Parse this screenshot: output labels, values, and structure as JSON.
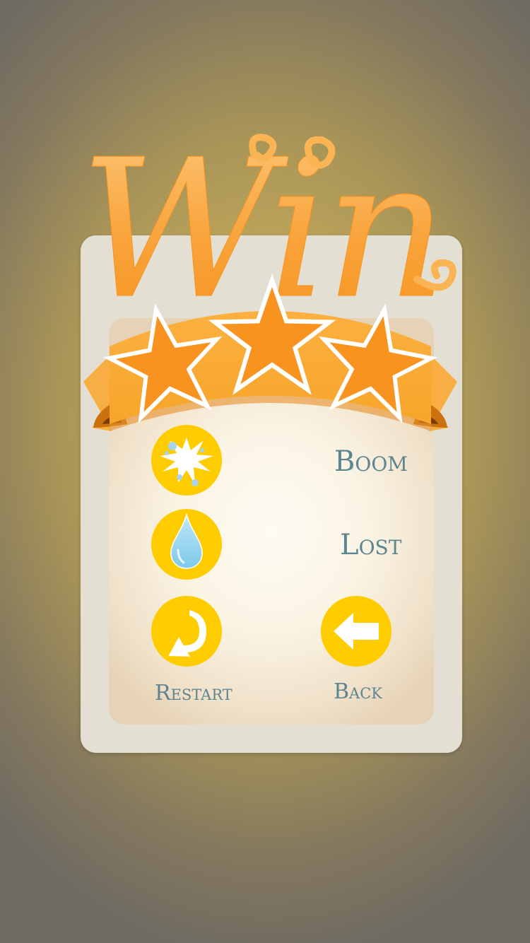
{
  "screen": {
    "title": "Win",
    "stars_earned": 3,
    "stars_total": 3
  },
  "stats": {
    "boom_label": "Boom",
    "lost_label": "Lost"
  },
  "buttons": {
    "restart_label": "Restart",
    "back_label": "Back"
  },
  "colors": {
    "title_orange": "#f7931e",
    "star_orange": "#f7931e",
    "ribbon_orange": "#fbb040",
    "button_yellow": "#ffcc00",
    "label_teal": "#5d8590"
  },
  "icons": {
    "boom": "explosion-icon",
    "lost": "water-drop-icon",
    "restart": "restart-arrow-icon",
    "back": "back-arrow-icon"
  }
}
